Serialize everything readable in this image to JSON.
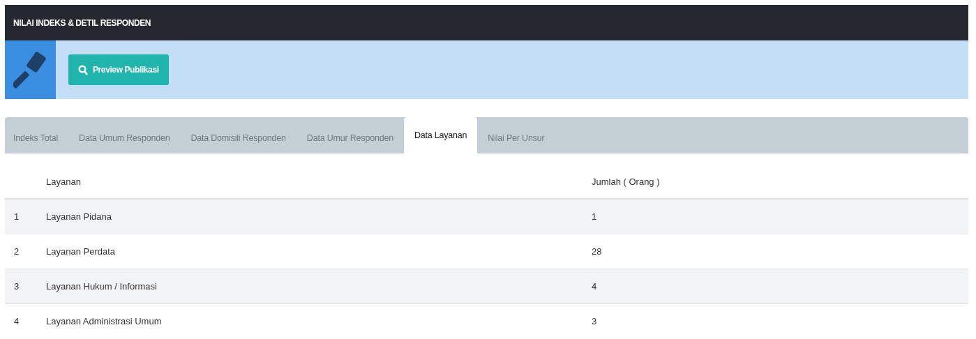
{
  "header": {
    "title": "NILAI INDEKS & DETIL RESPONDEN"
  },
  "toolbar": {
    "button": "Preview Publikasi"
  },
  "tabs": [
    {
      "label": "Indeks Total",
      "selected": false
    },
    {
      "label": "Data Umum Responden",
      "selected": false
    },
    {
      "label": "Data Domisili Responden",
      "selected": false
    },
    {
      "label": "Data Umur Responden",
      "selected": false
    },
    {
      "label": "Data Layanan",
      "selected": true
    },
    {
      "label": "Nilai Per Unsur",
      "selected": false
    }
  ],
  "table": {
    "columns": [
      "Layanan",
      "Jumlah ( Orang )"
    ],
    "rows": [
      {
        "no": "1",
        "layanan": "Layanan Pidana",
        "jumlah": "1"
      },
      {
        "no": "2",
        "layanan": "Layanan Perdata",
        "jumlah": "28"
      },
      {
        "no": "3",
        "layanan": "Layanan Hukum / Informasi",
        "jumlah": "4"
      },
      {
        "no": "4",
        "layanan": "Layanan Administrasi Umum",
        "jumlah": "3"
      }
    ]
  }
}
